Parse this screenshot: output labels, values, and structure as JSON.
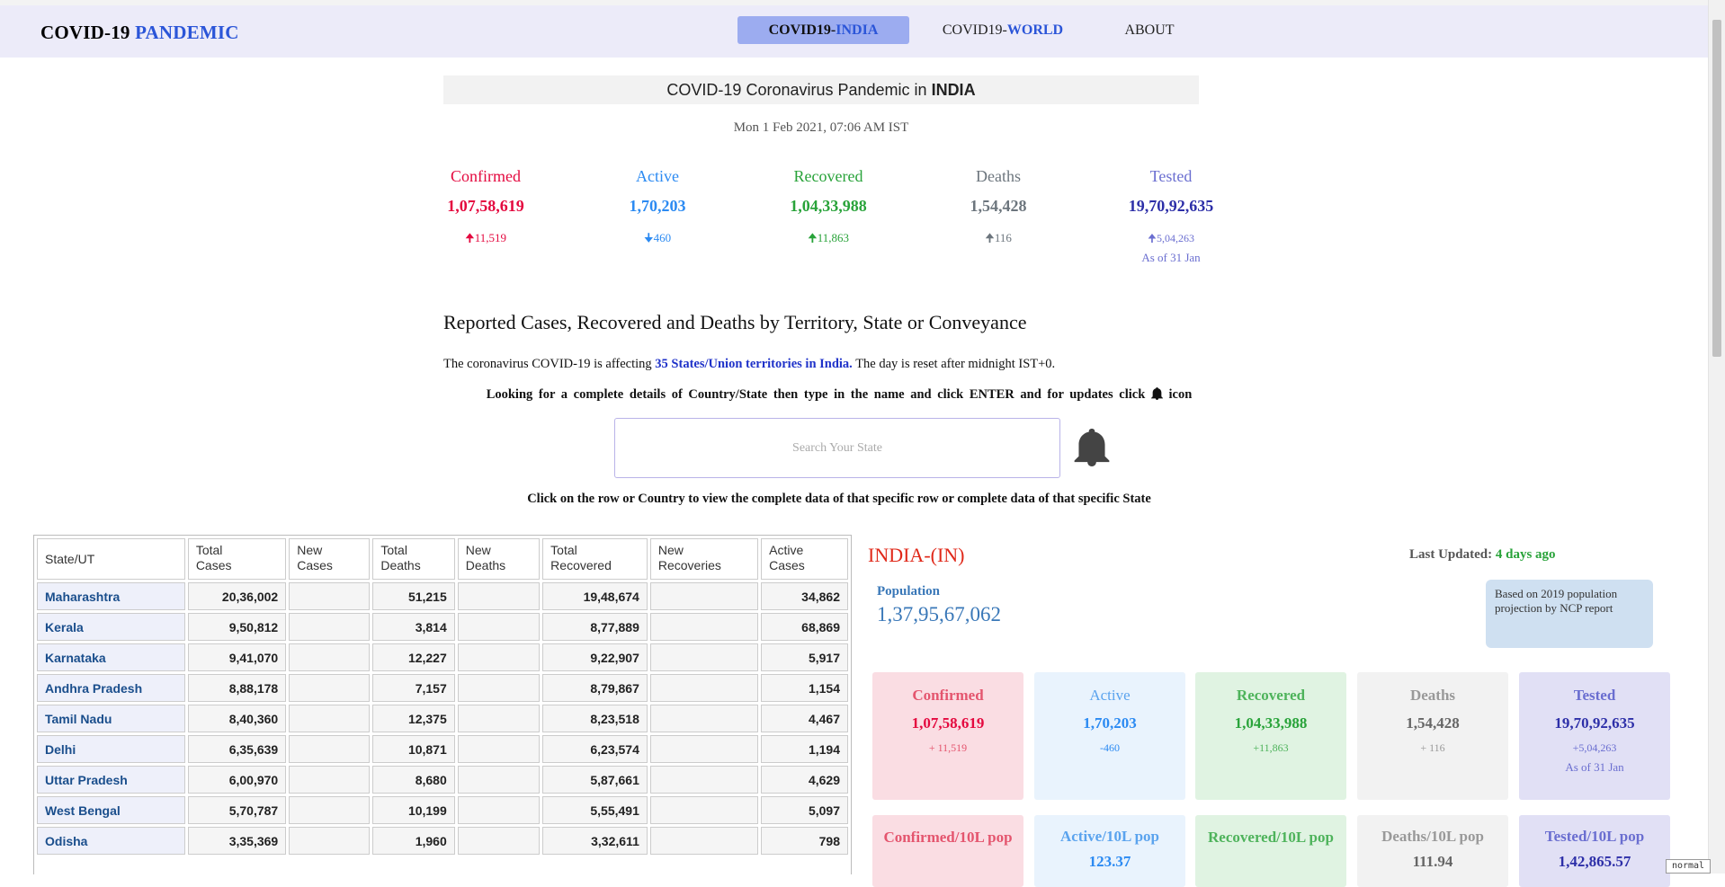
{
  "nav": {
    "brand_prefix": "COVID-19",
    "brand_highlight": "PANDEMIC",
    "india_prefix": "COVID19-",
    "india_highlight": "INDIA",
    "world_prefix": "COVID19-",
    "world_highlight": "WORLD",
    "about": "ABOUT"
  },
  "header": {
    "title_prefix": "COVID-19 Coronavirus Pandemic in",
    "title_country": "INDIA",
    "date": "Mon 1 Feb 2021, 07:06 AM IST"
  },
  "summary": {
    "confirmed": {
      "label": "Confirmed",
      "value": "1,07,58,619",
      "delta": "11,519",
      "color": "#e4093f"
    },
    "active": {
      "label": "Active",
      "value": "1,70,203",
      "delta": "460",
      "color": "#2b8af2"
    },
    "recovered": {
      "label": "Recovered",
      "value": "1,04,33,988",
      "delta": "11,863",
      "color": "#29a33a"
    },
    "deaths": {
      "label": "Deaths",
      "value": "1,54,428",
      "delta": "116",
      "color": "#6c757d"
    },
    "tested": {
      "label": "Tested",
      "value": "19,70,92,635",
      "delta": "5,04,263",
      "as_of": "As of 31 Jan",
      "color": "#2d2fa8"
    }
  },
  "section": {
    "heading": "Reported Cases, Recovered and Deaths by Territory, State or Conveyance",
    "affect_prefix": "The coronavirus COVID-19 is affecting",
    "affect_link": "35 States/Union territories in India.",
    "affect_suffix": "The day is reset after midnight IST+0.",
    "help_prefix": "Looking for a complete details of Country/State then type in the name and click ENTER and for updates click",
    "help_suffix": "icon",
    "search_placeholder": "Search Your State",
    "click_line": "Click on the row or Country to view the complete data of that specific row or complete data of that specific State"
  },
  "table": {
    "headers": [
      [
        "State/UT"
      ],
      [
        "Total",
        "Cases"
      ],
      [
        "New",
        "Cases"
      ],
      [
        "Total",
        "Deaths"
      ],
      [
        "New",
        "Deaths"
      ],
      [
        "Total",
        "Recovered"
      ],
      [
        "New",
        "Recoveries"
      ],
      [
        "Active",
        "Cases"
      ]
    ],
    "rows": [
      {
        "state": "Maharashtra",
        "total_cases": "20,36,002",
        "new_cases": "",
        "total_deaths": "51,215",
        "new_deaths": "",
        "total_recovered": "19,48,674",
        "new_recoveries": "",
        "active": "34,862"
      },
      {
        "state": "Kerala",
        "total_cases": "9,50,812",
        "new_cases": "",
        "total_deaths": "3,814",
        "new_deaths": "",
        "total_recovered": "8,77,889",
        "new_recoveries": "",
        "active": "68,869"
      },
      {
        "state": "Karnataka",
        "total_cases": "9,41,070",
        "new_cases": "",
        "total_deaths": "12,227",
        "new_deaths": "",
        "total_recovered": "9,22,907",
        "new_recoveries": "",
        "active": "5,917"
      },
      {
        "state": "Andhra Pradesh",
        "total_cases": "8,88,178",
        "new_cases": "",
        "total_deaths": "7,157",
        "new_deaths": "",
        "total_recovered": "8,79,867",
        "new_recoveries": "",
        "active": "1,154"
      },
      {
        "state": "Tamil Nadu",
        "total_cases": "8,40,360",
        "new_cases": "",
        "total_deaths": "12,375",
        "new_deaths": "",
        "total_recovered": "8,23,518",
        "new_recoveries": "",
        "active": "4,467"
      },
      {
        "state": "Delhi",
        "total_cases": "6,35,639",
        "new_cases": "",
        "total_deaths": "10,871",
        "new_deaths": "",
        "total_recovered": "6,23,574",
        "new_recoveries": "",
        "active": "1,194"
      },
      {
        "state": "Uttar Pradesh",
        "total_cases": "6,00,970",
        "new_cases": "",
        "total_deaths": "8,680",
        "new_deaths": "",
        "total_recovered": "5,87,661",
        "new_recoveries": "",
        "active": "4,629"
      },
      {
        "state": "West Bengal",
        "total_cases": "5,70,787",
        "new_cases": "",
        "total_deaths": "10,199",
        "new_deaths": "",
        "total_recovered": "5,55,491",
        "new_recoveries": "",
        "active": "5,097"
      },
      {
        "state": "Odisha",
        "total_cases": "3,35,369",
        "new_cases": "",
        "total_deaths": "1,960",
        "new_deaths": "",
        "total_recovered": "3,32,611",
        "new_recoveries": "",
        "active": "798"
      }
    ]
  },
  "panel": {
    "title": "INDIA-(IN)",
    "last_updated_label": "Last Updated:",
    "last_updated_value": "4 days ago",
    "population_label": "Population",
    "population_value": "1,37,95,67,062",
    "note": "Based on 2019 population projection by NCP report",
    "cards": {
      "confirmed": {
        "label": "Confirmed",
        "value": "1,07,58,619",
        "delta": "+ 11,519"
      },
      "active": {
        "label": "Active",
        "value": "1,70,203",
        "delta": "-460"
      },
      "recovered": {
        "label": "Recovered",
        "value": "1,04,33,988",
        "delta": "+11,863"
      },
      "deaths": {
        "label": "Deaths",
        "value": "1,54,428",
        "delta": "+ 116"
      },
      "tested": {
        "label": "Tested",
        "value": "19,70,92,635",
        "delta": "+5,04,263",
        "as_of": "As of 31 Jan"
      }
    },
    "per_pop": {
      "confirmed": {
        "label": "Confirmed/10L pop",
        "value": ""
      },
      "active": {
        "label": "Active/10L pop",
        "value": "123.37"
      },
      "recovered": {
        "label": "Recovered/10L pop",
        "value": ""
      },
      "deaths": {
        "label": "Deaths/10L pop",
        "value": "111.94"
      },
      "tested": {
        "label": "Tested/10L pop",
        "value": "1,42,865.57"
      }
    }
  },
  "status_tag": "normal"
}
